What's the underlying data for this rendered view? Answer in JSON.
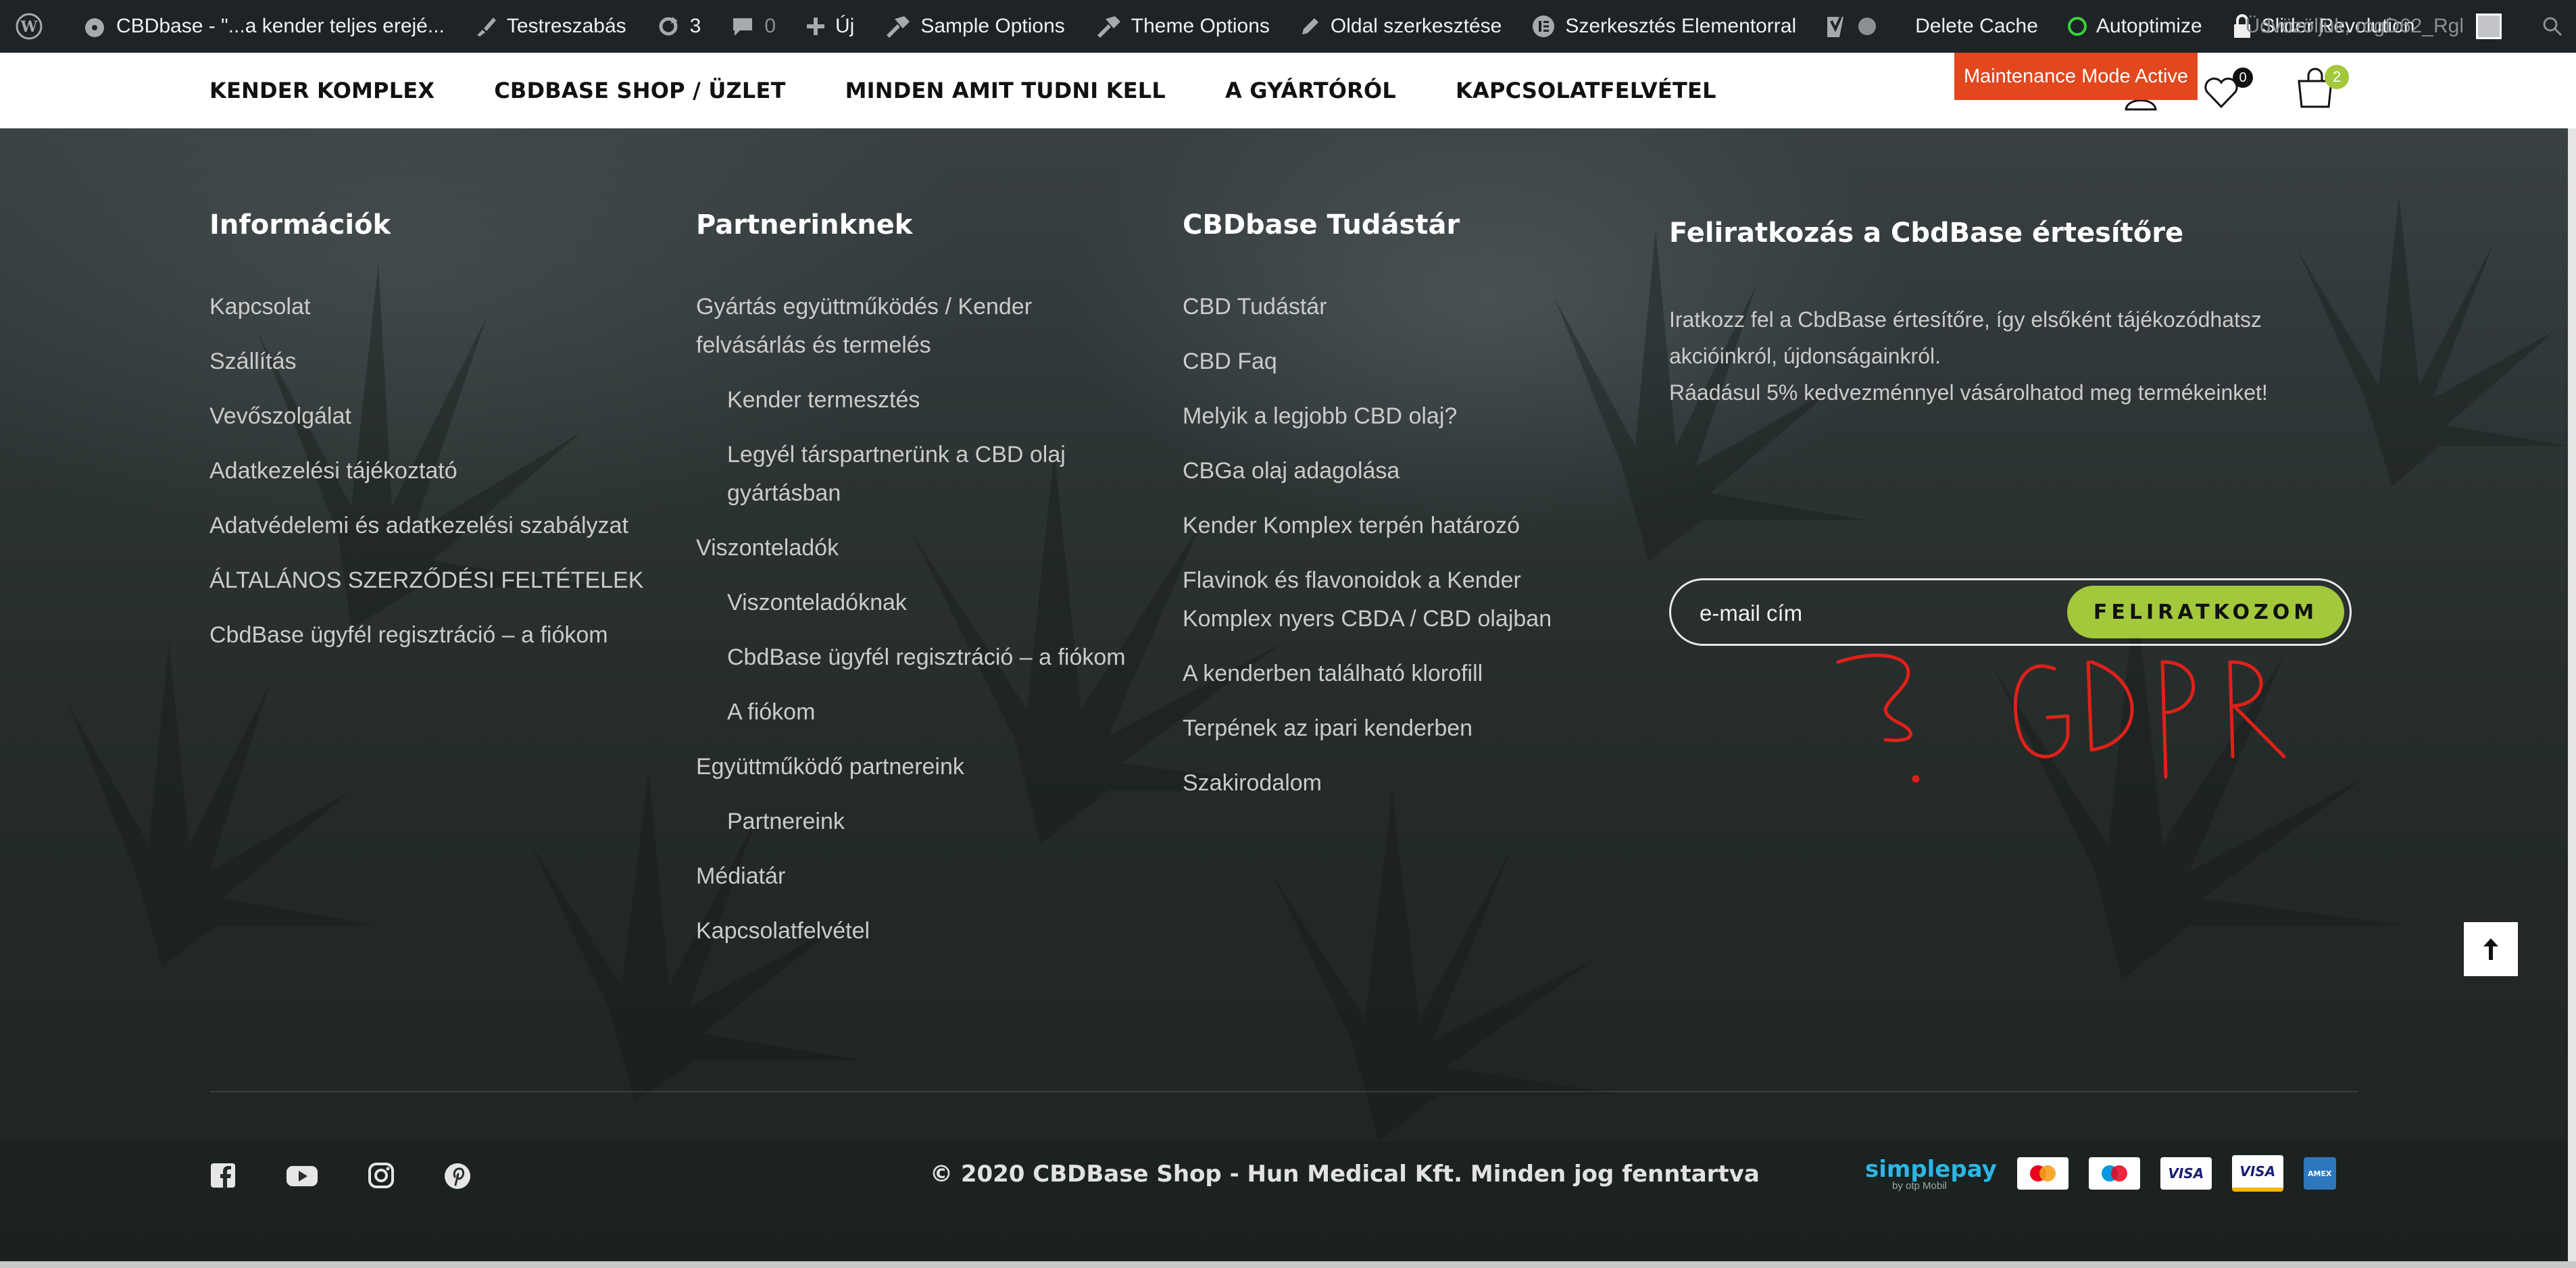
{
  "admin_bar": {
    "site_title": "CBDbase - \"...a kender teljes erejé...",
    "customize": "Testreszabás",
    "updates_count": "3",
    "comments_count": "0",
    "new": "Új",
    "sample_options": "Sample Options",
    "theme_options": "Theme Options",
    "edit_page": "Oldal szerkesztése",
    "edit_elementor": "Szerkesztés Elementorral",
    "delete_cache": "Delete Cache",
    "autoptimize": "Autoptimize",
    "slider_revolution": "Slider Revolution",
    "user": "Üdvözöljük, rogD62_Rgl"
  },
  "maintenance_notice": "Maintenance Mode Active",
  "nav": {
    "items": [
      "KENDER KOMPLEX",
      "CBDBASE SHOP / ÜZLET",
      "MINDEN AMIT TUDNI KELL",
      "A GYÁRTÓRÓL",
      "KAPCSOLATFELVÉTEL"
    ],
    "wishlist_count": "0",
    "cart_count": "2"
  },
  "footer": {
    "col1": {
      "title": "Információk",
      "items": [
        "Kapcsolat",
        "Szállítás",
        "Vevőszolgálat",
        "Adatkezelési tájékoztató",
        "Adatvédelemi és adatkezelési szabályzat",
        "ÁLTALÁNOS SZERZŐDÉSI FELTÉTELEK",
        "CbdBase ügyfél regisztráció – a fiókom"
      ]
    },
    "col2": {
      "title": "Partnerinknek",
      "items": [
        "Gyártás együttműködés / Kender felvásárlás és termelés",
        "Kender termesztés",
        "Legyél társpartnerünk a CBD olaj gyártásban",
        "Viszonteladók",
        "Viszonteladóknak",
        "CbdBase ügyfél regisztráció – a fiókom",
        "A fiókom",
        "Együttműködő partnereink",
        "Partnereink",
        "Médiatár",
        "Kapcsolatfelvétel"
      ]
    },
    "col3": {
      "title": "CBDbase Tudástár",
      "items": [
        "CBD Tudástár",
        "CBD Faq",
        "Melyik a legjobb CBD olaj?",
        "CBGa olaj adagolása",
        "Kender Komplex terpén határozó",
        "Flavinok és flavonoidok a Kender Komplex nyers CBDA / CBD olajban",
        "A kenderben található klorofill",
        "Terpének az ipari kenderben",
        "Szakirodalom"
      ]
    },
    "newsletter": {
      "title": "Feliratkozás a CbdBase értesítőre",
      "text1": "Iratkozz fel a CbdBase értesítőre, így elsőként tájékozódhatsz akcióinkról, újdonságainkról.",
      "text2": "Ráadásul 5% kedvezménnyel vásárolhatod meg termékeinket!",
      "placeholder": "e-mail cím",
      "button": "FELIRATKOZOM"
    },
    "annotation": "? GDPR",
    "copyright": "© 2020 CBDBase Shop - Hun Medical Kft. Minden jog fenntartva",
    "payments": {
      "simplepay": "simplepay",
      "simplepay_sub": "by otp Mobil",
      "cards": [
        "mastercard",
        "maestro",
        "VISA",
        "VISA",
        "AMEX"
      ]
    },
    "social": [
      "facebook-icon",
      "youtube-icon",
      "instagram-icon",
      "pinterest-icon"
    ]
  },
  "colors": {
    "accent": "#a3c83b",
    "maintenance": "#e2471d",
    "admin_bar": "#1d2327",
    "annotation": "#e0201a"
  }
}
